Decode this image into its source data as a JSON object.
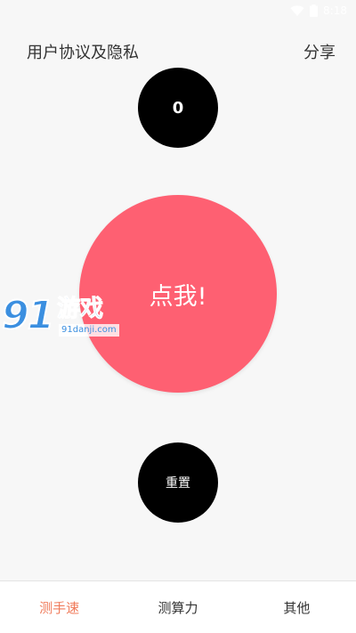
{
  "status_bar": {
    "time": "8:18",
    "icons": [
      "wifi-icon",
      "battery-icon"
    ]
  },
  "header": {
    "left_label": "用户协议及隐私",
    "right_label": "分享"
  },
  "counter": {
    "value": "0"
  },
  "tap_button": {
    "label": "点我!"
  },
  "watermark": {
    "number": "91",
    "text": "游戏",
    "url": "91danji.com"
  },
  "reset_button": {
    "label": "重置"
  },
  "bottom_nav": {
    "items": [
      {
        "label": "测手速"
      },
      {
        "label": "测算力"
      },
      {
        "label": "其他"
      }
    ],
    "active_index": 0
  },
  "colors": {
    "accent": "#fe6072",
    "active_tab": "#f07c5c",
    "watermark_blue": "#3b8fe0"
  }
}
